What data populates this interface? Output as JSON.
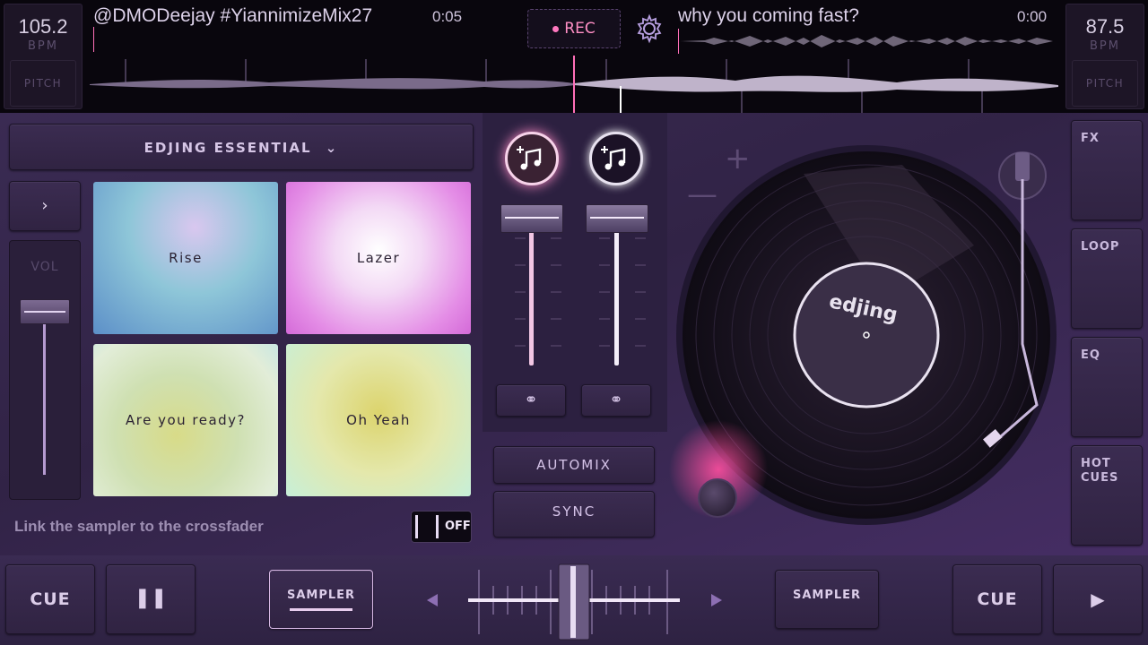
{
  "deck_left": {
    "bpm": "105.2",
    "bpm_unit": "BPM",
    "pitch_label": "PITCH",
    "track_title": "@DMODeejay #YiannimizeMix27",
    "time": "0:05"
  },
  "deck_right": {
    "bpm": "87.5",
    "bpm_unit": "BPM",
    "pitch_label": "PITCH",
    "track_title": "why you coming fast?",
    "time": "0:00"
  },
  "header": {
    "rec_label": "REC",
    "settings_icon": "gear-icon"
  },
  "sampler": {
    "pack_name": "EDJING ESSENTIAL",
    "volume_label": "VOL",
    "pads": [
      {
        "label": "Rise"
      },
      {
        "label": "Lazer"
      },
      {
        "label": "Are you ready?"
      },
      {
        "label": "Oh Yeah"
      }
    ],
    "crossfader_link_text": "Link the sampler to the crossfader",
    "toggle_state": "OFF"
  },
  "mixer": {
    "automix_label": "AUTOMIX",
    "sync_label": "SYNC"
  },
  "turntable": {
    "label_text": "edjing"
  },
  "side_buttons": {
    "fx": "FX",
    "loop": "LOOP",
    "eq": "EQ",
    "hot_cues": "HOT CUES"
  },
  "transport": {
    "cue_left": "CUE",
    "cue_right": "CUE",
    "sampler_left": "SAMPLER",
    "sampler_right": "SAMPLER"
  },
  "colors": {
    "accent_pink": "#ff78bf",
    "panel_bg": "#3a2b53",
    "topbar_bg": "#09060d"
  }
}
